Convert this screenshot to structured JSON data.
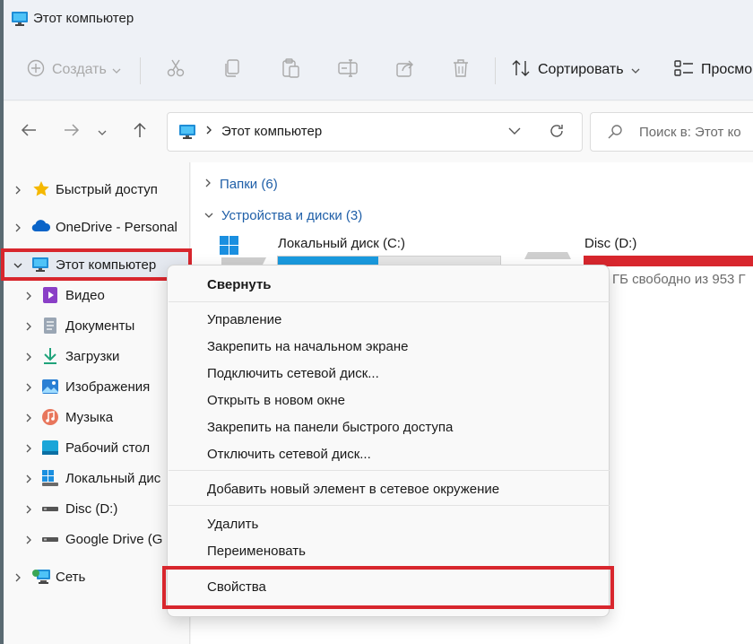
{
  "window": {
    "title": "Этот компьютер"
  },
  "toolbar": {
    "new_label": "Создать",
    "sort_label": "Сортировать",
    "view_label": "Просмо"
  },
  "address": {
    "path": "Этот компьютер"
  },
  "search": {
    "placeholder": "Поиск в: Этот ко"
  },
  "sidebar": {
    "items": [
      {
        "label": "Быстрый доступ"
      },
      {
        "label": "OneDrive - Personal"
      },
      {
        "label": "Этот компьютер"
      },
      {
        "label": "Видео"
      },
      {
        "label": "Документы"
      },
      {
        "label": "Загрузки"
      },
      {
        "label": "Изображения"
      },
      {
        "label": "Музыка"
      },
      {
        "label": "Рабочий стол"
      },
      {
        "label": "Локальный дис"
      },
      {
        "label": "Disc (D:)"
      },
      {
        "label": "Google Drive (G"
      },
      {
        "label": "Сеть"
      }
    ]
  },
  "main": {
    "folders_group": "Папки (6)",
    "devices_group": "Устройства и диски (3)",
    "drives": [
      {
        "name": "Локальный диск (C:)",
        "used_fraction": 0.45,
        "bar_color": "#1a9be0"
      },
      {
        "name": "Disc (D:)",
        "used_fraction": 1.0,
        "bar_color": "#d8262d"
      }
    ],
    "partial_free_text": "ГБ свободно из 953 Г"
  },
  "context_menu": {
    "items": [
      "Свернуть",
      "Управление",
      "Закрепить на начальном экране",
      "Подключить сетевой диск...",
      "Открыть в новом окне",
      "Закрепить на панели быстрого доступа",
      "Отключить сетевой диск...",
      "Добавить новый элемент в сетевое окружение",
      "Удалить",
      "Переименовать",
      "Свойства"
    ]
  },
  "colors": {
    "highlight_box": "#d8262d",
    "accent": "#1f5fa8"
  }
}
